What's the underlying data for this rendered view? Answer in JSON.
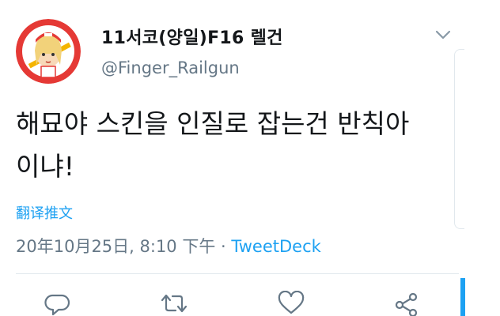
{
  "tweet": {
    "display_name": "11서코(양일)F16 렐건",
    "handle": "@Finger_Railgun",
    "text": "해묘야 스킨을 인질로 잡는건 반칙아\n이냐!",
    "translate_label": "翻译推文",
    "timestamp": "20年10月25日, 8:10 下午",
    "separator": " · ",
    "source": "TweetDeck"
  },
  "icons": {
    "caret": "chevron-down-icon",
    "reply": "reply-icon",
    "retweet": "retweet-icon",
    "like": "heart-icon",
    "share": "share-icon"
  },
  "colors": {
    "text": "#14171a",
    "secondary": "#657786",
    "accent": "#1da1f2",
    "avatar_bg": "#e53935",
    "divider": "#e1e8ed"
  }
}
